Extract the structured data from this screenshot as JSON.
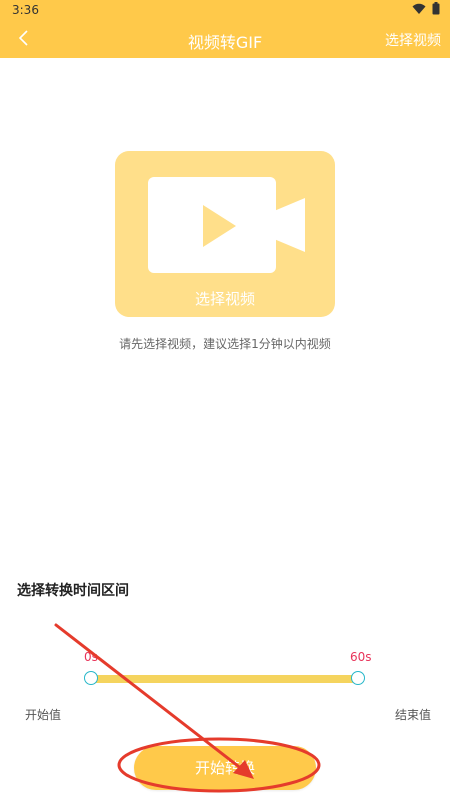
{
  "status_bar": {
    "time": "3:36",
    "wifi_icon": "wifi-icon",
    "battery_icon": "battery-icon"
  },
  "app_bar": {
    "back_icon": "chevron-left-icon",
    "title": "视频转GIF",
    "action_label": "选择视频"
  },
  "picker": {
    "icon": "video-camera-icon",
    "label": "选择视频"
  },
  "hint": "请先选择视频，建议选择1分钟以内视频",
  "range": {
    "title": "选择转换时间区间",
    "start_value": "0s",
    "end_value": "60s",
    "start_label": "开始值",
    "end_label": "结束值",
    "min_seconds": 0,
    "max_seconds": 60
  },
  "start_button": {
    "label": "开始转换"
  },
  "colors": {
    "accent": "#FFC94A",
    "picker_bg": "#FFDF8A",
    "value_text": "#E8345A",
    "annotation": "#E53B2C"
  }
}
